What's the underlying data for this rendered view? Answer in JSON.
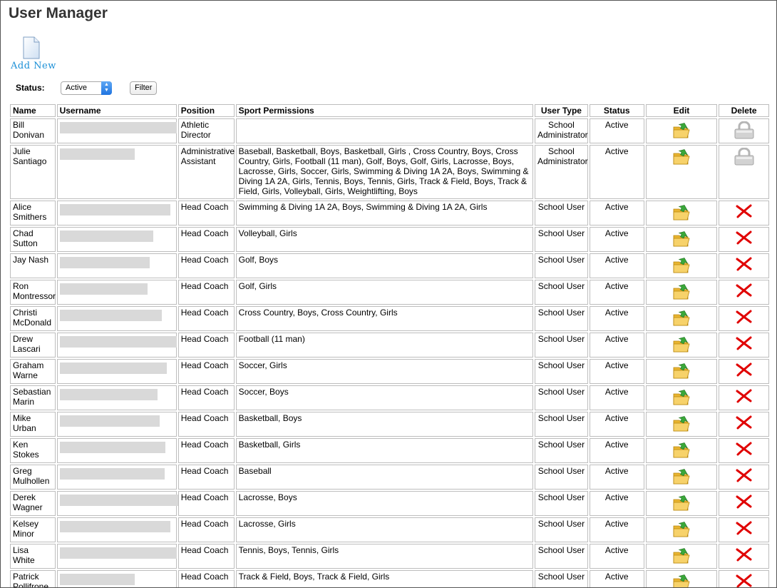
{
  "page": {
    "title": "User Manager"
  },
  "add_new": {
    "label": "Add New",
    "icon": "new-document-icon"
  },
  "filter": {
    "status_label": "Status:",
    "status_value": "Active",
    "filter_button": "Filter"
  },
  "table": {
    "headers": [
      "Name",
      "Username",
      "Position",
      "Sport Permissions",
      "User Type",
      "Status",
      "Edit",
      "Delete"
    ],
    "rows": [
      {
        "name": "Bill Donivan",
        "username": "",
        "position": "Athletic Director",
        "permissions": "",
        "user_type": "School Administrator",
        "status": "Active",
        "delete_icon": "lock-icon"
      },
      {
        "name": "Julie Santiago",
        "username": "",
        "position": "Administrative Assistant",
        "permissions": "Baseball, Basketball, Boys, Basketball, Girls , Cross Country, Boys, Cross Country, Girls, Football (11 man), Golf, Boys, Golf, Girls, Lacrosse, Boys, Lacrosse, Girls, Soccer, Girls, Swimming & Diving 1A 2A, Boys, Swimming & Diving 1A 2A, Girls, Tennis, Boys, Tennis, Girls, Track & Field, Boys, Track & Field, Girls, Volleyball, Girls, Weightlifting, Boys",
        "user_type": "School Administrator",
        "status": "Active",
        "delete_icon": "lock-icon"
      },
      {
        "name": "Alice Smithers",
        "username": "",
        "position": "Head Coach",
        "permissions": "Swimming & Diving 1A 2A, Boys, Swimming & Diving 1A 2A, Girls",
        "user_type": "School User",
        "status": "Active",
        "delete_icon": "delete-x-icon"
      },
      {
        "name": "Chad Sutton",
        "username": "",
        "position": "Head Coach",
        "permissions": "Volleyball, Girls",
        "user_type": "School User",
        "status": "Active",
        "delete_icon": "delete-x-icon"
      },
      {
        "name": "Jay Nash",
        "username": "",
        "position": "Head Coach",
        "permissions": "Golf, Boys",
        "user_type": "School User",
        "status": "Active",
        "delete_icon": "delete-x-icon"
      },
      {
        "name": "Ron Montressor",
        "username": "",
        "position": "Head Coach",
        "permissions": "Golf, Girls",
        "user_type": "School User",
        "status": "Active",
        "delete_icon": "delete-x-icon"
      },
      {
        "name": "Christi McDonald",
        "username": "",
        "position": "Head Coach",
        "permissions": "Cross Country, Boys, Cross Country, Girls",
        "user_type": "School User",
        "status": "Active",
        "delete_icon": "delete-x-icon"
      },
      {
        "name": "Drew Lascari",
        "username": "",
        "position": "Head Coach",
        "permissions": "Football (11 man)",
        "user_type": "School User",
        "status": "Active",
        "delete_icon": "delete-x-icon"
      },
      {
        "name": "Graham Warne",
        "username": "",
        "position": "Head Coach",
        "permissions": "Soccer, Girls",
        "user_type": "School User",
        "status": "Active",
        "delete_icon": "delete-x-icon"
      },
      {
        "name": "Sebastian Marin",
        "username": "",
        "position": "Head Coach",
        "permissions": "Soccer, Boys",
        "user_type": "School User",
        "status": "Active",
        "delete_icon": "delete-x-icon"
      },
      {
        "name": "Mike Urban",
        "username": "",
        "position": "Head Coach",
        "permissions": "Basketball, Boys",
        "user_type": "School User",
        "status": "Active",
        "delete_icon": "delete-x-icon"
      },
      {
        "name": "Ken Stokes",
        "username": "",
        "position": "Head Coach",
        "permissions": "Basketball, Girls",
        "user_type": "School User",
        "status": "Active",
        "delete_icon": "delete-x-icon"
      },
      {
        "name": "Greg Mulhollen",
        "username": "",
        "position": "Head Coach",
        "permissions": "Baseball",
        "user_type": "School User",
        "status": "Active",
        "delete_icon": "delete-x-icon"
      },
      {
        "name": "Derek Wagner",
        "username": "",
        "position": "Head Coach",
        "permissions": "Lacrosse, Boys",
        "user_type": "School User",
        "status": "Active",
        "delete_icon": "delete-x-icon"
      },
      {
        "name": "Kelsey Minor",
        "username": "",
        "position": "Head Coach",
        "permissions": "Lacrosse, Girls",
        "user_type": "School User",
        "status": "Active",
        "delete_icon": "delete-x-icon"
      },
      {
        "name": "Lisa White",
        "username": "",
        "position": "Head Coach",
        "permissions": "Tennis, Boys, Tennis, Girls",
        "user_type": "School User",
        "status": "Active",
        "delete_icon": "delete-x-icon"
      },
      {
        "name": "Patrick Pollifrone",
        "username": "",
        "position": "Head Coach",
        "permissions": "Track & Field, Boys, Track & Field, Girls",
        "user_type": "School User",
        "status": "Active",
        "delete_icon": "delete-x-icon"
      }
    ]
  },
  "icons": {
    "edit": "edit-folder-icon",
    "delete": "delete-x-icon",
    "locked": "lock-icon"
  },
  "colors": {
    "link": "#1a8fd6",
    "delete_red": "#e00000",
    "folder": "#f2c94c"
  }
}
